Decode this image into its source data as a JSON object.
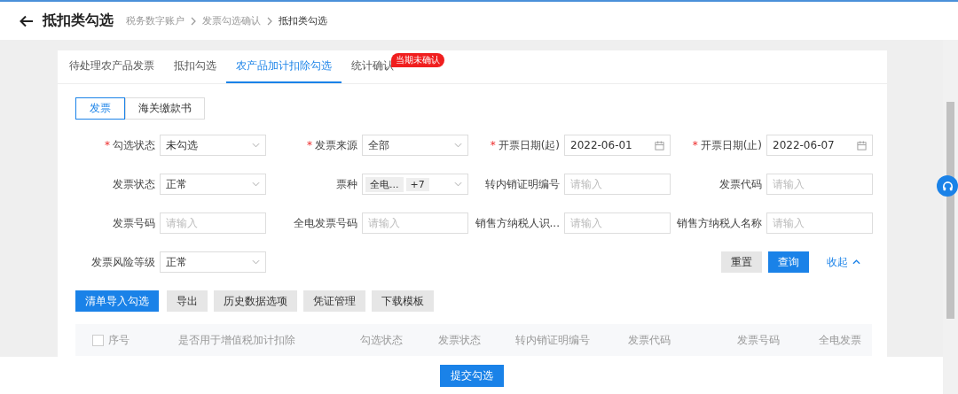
{
  "header": {
    "title": "抵扣类勾选",
    "breadcrumb": [
      "税务数字账户",
      "发票勾选确认",
      "抵扣类勾选"
    ]
  },
  "tabs": [
    {
      "label": "待处理农产品发票",
      "selected": false
    },
    {
      "label": "抵扣勾选",
      "selected": false
    },
    {
      "label": "农产品加计扣除勾选",
      "selected": true
    },
    {
      "label": "统计确认",
      "selected": false,
      "badge": "当期未确认"
    }
  ],
  "sub_tabs": [
    {
      "label": "发票",
      "selected": true
    },
    {
      "label": "海关缴款书",
      "selected": false
    }
  ],
  "filters": [
    {
      "label": "勾选状态",
      "required_mark": "*",
      "kind": "select",
      "value": "未勾选"
    },
    {
      "label": "发票来源",
      "required_mark": "*",
      "kind": "select",
      "value": "全部"
    },
    {
      "label": "开票日期(起)",
      "required_mark": "*",
      "kind": "date",
      "value": "2022-06-01"
    },
    {
      "label": "开票日期(止)",
      "required_mark": "*",
      "kind": "date",
      "value": "2022-06-07"
    },
    {
      "label": "发票状态",
      "kind": "select",
      "value": "正常"
    },
    {
      "label": "票种",
      "kind": "tags",
      "tags": [
        "全电...",
        "+7"
      ]
    },
    {
      "label": "转内销证明编号",
      "kind": "input",
      "placeholder": "请输入"
    },
    {
      "label": "发票代码",
      "kind": "input",
      "placeholder": "请输入"
    },
    {
      "label": "发票号码",
      "kind": "input",
      "placeholder": "请输入"
    },
    {
      "label": "全电发票号码",
      "kind": "input",
      "placeholder": "请输入"
    },
    {
      "label": "销售方纳税人识...",
      "kind": "input",
      "placeholder": "请输入"
    },
    {
      "label": "销售方纳税人名称",
      "kind": "input",
      "placeholder": "请输入"
    },
    {
      "label": "发票风险等级",
      "kind": "select",
      "value": "正常"
    }
  ],
  "filter_actions": {
    "reset": "重置",
    "query": "查询",
    "collapse": "收起"
  },
  "toolbar_buttons": [
    {
      "label": "清单导入勾选",
      "kind": "primary"
    },
    {
      "label": "导出",
      "kind": "default"
    },
    {
      "label": "历史数据选项",
      "kind": "default"
    },
    {
      "label": "凭证管理",
      "kind": "default"
    },
    {
      "label": "下载模板",
      "kind": "default"
    }
  ],
  "table": {
    "select_all_checked": false,
    "columns": [
      "序号",
      "是否用于增值税加计扣除",
      "勾选状态",
      "发票状态",
      "转内销证明编号",
      "发票代码",
      "发票号码",
      "全电发票"
    ]
  },
  "footer": {
    "submit": "提交勾选"
  }
}
